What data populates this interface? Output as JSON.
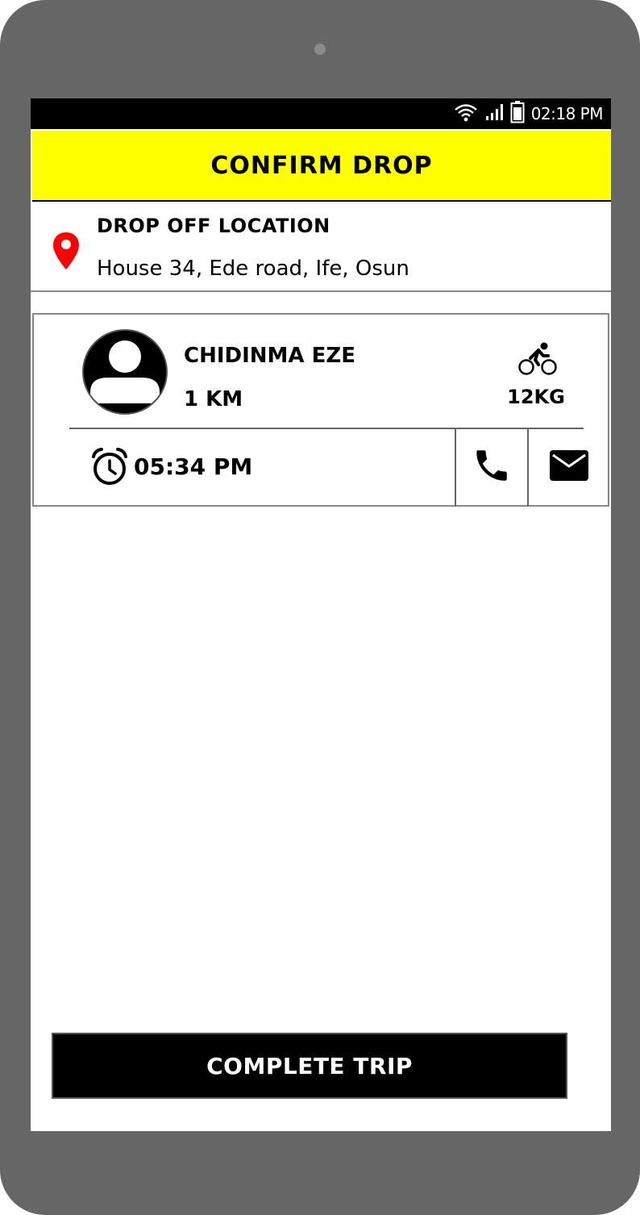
{
  "status_bar": {
    "time": "02:18 PM",
    "icons": [
      "wifi-icon",
      "signal-icon",
      "battery-icon"
    ]
  },
  "header": {
    "title": "CONFIRM DROP",
    "background_color": "#ffff00"
  },
  "drop_off": {
    "label": "DROP OFF LOCATION",
    "address": "House 34, Ede road, Ife, Osun",
    "pin_color": "#ff0000",
    "icon": "location-pin-icon"
  },
  "rider": {
    "name": "CHIDINMA EZE",
    "distance": "1 KM",
    "weight": "12KG",
    "eta": "05:34 PM",
    "avatar_icon": "user-avatar-icon",
    "vehicle_icon": "bicycle-icon",
    "eta_icon": "alarm-clock-icon"
  },
  "actions": {
    "call_icon": "phone-icon",
    "message_icon": "mail-icon",
    "complete_label": "COMPLETE TRIP"
  }
}
